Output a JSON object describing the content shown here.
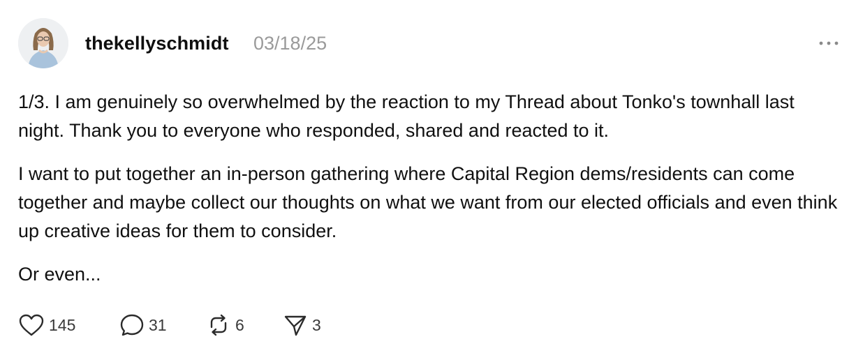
{
  "post": {
    "author": "thekellyschmidt",
    "date": "03/18/25",
    "paragraphs": [
      "1/3. I am genuinely so overwhelmed by the reaction to my Thread about Tonko's townhall last night. Thank you to everyone who responded, shared and reacted to it.",
      "I want to put together an in-person gathering where Capital Region dems/residents can come together and maybe collect our thoughts on what we want from our elected officials and even think up creative ideas for them to consider.",
      "Or even..."
    ],
    "actions": {
      "likes": "145",
      "replies": "31",
      "reposts": "6",
      "shares": "3"
    }
  },
  "icons": {
    "avatar": "profile-photo",
    "more": "more-horizontal-icon",
    "like": "heart-icon",
    "reply": "speech-bubble-icon",
    "repost": "repost-icon",
    "share": "paper-plane-icon"
  },
  "colors": {
    "text": "#101010",
    "muted": "#9a9a9a",
    "icon": "#2b2b2b"
  }
}
